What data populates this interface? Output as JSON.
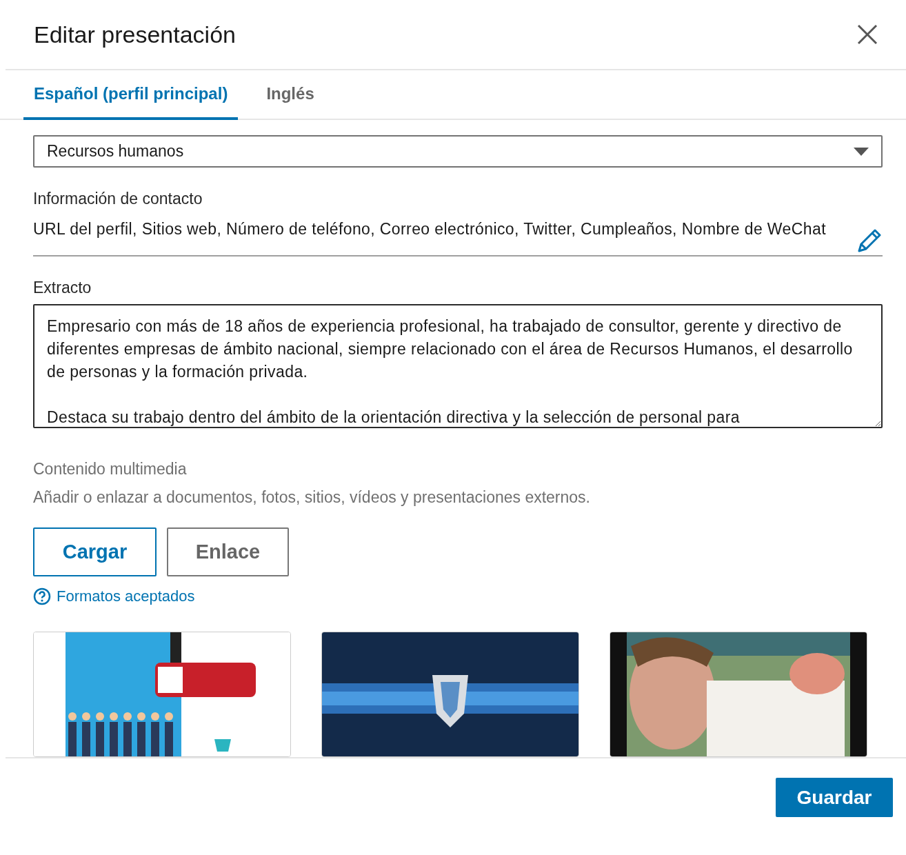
{
  "dialog": {
    "title": "Editar presentación"
  },
  "tabs": [
    {
      "label": "Español (perfil principal)",
      "selected": true
    },
    {
      "label": "Inglés",
      "selected": false
    }
  ],
  "sector": {
    "value": "Recursos humanos"
  },
  "contact": {
    "label": "Información de contacto",
    "value": "URL del perfil, Sitios web, Número de teléfono, Correo electrónico, Twitter, Cumpleaños, Nombre de WeChat"
  },
  "summary": {
    "label": "Extracto",
    "value": "Empresario con más de 18 años de experiencia profesional, ha trabajado de consultor, gerente y directivo de diferentes empresas de ámbito nacional, siempre relacionado con el área de Recursos Humanos, el desarrollo de personas y la formación privada.\n\nDestaca su trabajo dentro del ámbito de la orientación directiva y la selección de personal para"
  },
  "media": {
    "label": "Contenido multimedia",
    "hint": "Añadir o enlazar a documentos, fotos, sitios, vídeos y presentaciones externos.",
    "buttons": [
      {
        "label": "Cargar",
        "kind": "primary"
      },
      {
        "label": "Enlace",
        "kind": "secondary"
      }
    ],
    "formats_link": "Formatos aceptados"
  },
  "footer": {
    "save": "Guardar"
  }
}
